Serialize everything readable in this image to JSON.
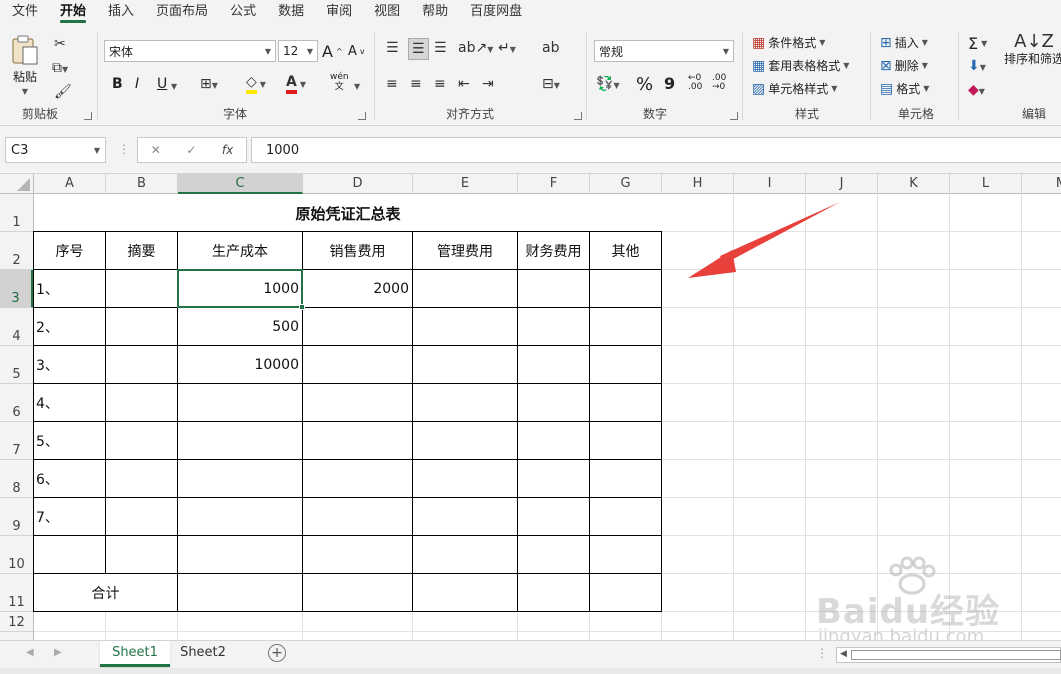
{
  "menu": [
    "文件",
    "开始",
    "插入",
    "页面布局",
    "公式",
    "数据",
    "审阅",
    "视图",
    "帮助",
    "百度网盘"
  ],
  "menu_active": "开始",
  "ribbon": {
    "clipboard": {
      "label": "剪贴板",
      "paste": "粘贴"
    },
    "font": {
      "label": "字体",
      "font_name": "宋体",
      "font_size": "12",
      "bold": "B",
      "italic": "I",
      "underline": "U",
      "grow": "A",
      "shrink": "A",
      "phonetic": "wén 文"
    },
    "alignment": {
      "label": "对齐方式"
    },
    "number": {
      "label": "数字",
      "format": "常规",
      "percent": "%",
      "comma": "9",
      "inc_decimal": "←0 .00",
      "dec_decimal": ".00 →0"
    },
    "styles": {
      "label": "样式",
      "conditional": "条件格式",
      "table": "套用表格格式",
      "cell_styles": "单元格样式"
    },
    "cells": {
      "label": "单元格",
      "insert": "插入",
      "delete": "删除",
      "format": "格式"
    },
    "editing": {
      "label": "编辑",
      "sort": "排序和筛选",
      "sum": "Σ"
    }
  },
  "formula_bar": {
    "name_box": "C3",
    "cancel": "✕",
    "enter": "✓",
    "fx": "fx",
    "formula": "1000"
  },
  "columns": [
    "A",
    "B",
    "C",
    "D",
    "E",
    "F",
    "G",
    "H",
    "I",
    "J",
    "K",
    "L",
    "M"
  ],
  "rows": [
    "1",
    "2",
    "3",
    "4",
    "5",
    "6",
    "7",
    "8",
    "9",
    "10",
    "11",
    "12"
  ],
  "sheet": {
    "title": "原始凭证汇总表",
    "headers": [
      "序号",
      "摘要",
      "生产成本",
      "销售费用",
      "管理费用",
      "财务费用",
      "其他"
    ],
    "data_rows": [
      [
        "1、",
        "",
        "1000",
        "2000",
        "",
        "",
        ""
      ],
      [
        "2、",
        "",
        "500",
        "",
        "",
        "",
        ""
      ],
      [
        "3、",
        "",
        "10000",
        "",
        "",
        "",
        ""
      ],
      [
        "4、",
        "",
        "",
        "",
        "",
        "",
        ""
      ],
      [
        "5、",
        "",
        "",
        "",
        "",
        "",
        ""
      ],
      [
        "6、",
        "",
        "",
        "",
        "",
        "",
        ""
      ],
      [
        "7、",
        "",
        "",
        "",
        "",
        "",
        ""
      ],
      [
        "",
        "",
        "",
        "",
        "",
        "",
        ""
      ]
    ],
    "total_label": "合计"
  },
  "active_cell": "C3",
  "tabs": [
    "Sheet1",
    "Sheet2"
  ],
  "active_tab": "Sheet1",
  "add_sheet": "+",
  "watermark": {
    "text": "Baidu经验",
    "sub": "jingyan.baidu.com"
  },
  "colors": {
    "accent": "#217346",
    "arrow": "#e8403a"
  }
}
